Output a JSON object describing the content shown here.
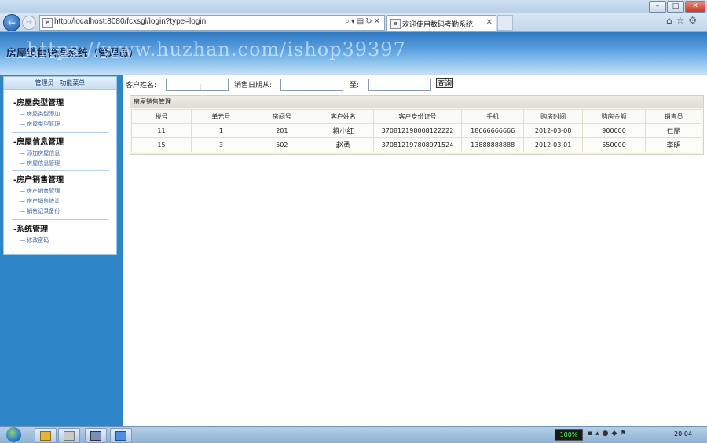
{
  "browser": {
    "url": "http://localhost:8080/fcxsgl/login?type=login",
    "tab_title": "欢迎使用数码考勤系统",
    "tab_close": "✕",
    "window_buttons": {
      "minimize": "–",
      "maximize": "□",
      "close": "✕"
    }
  },
  "header": {
    "title": "房屋销售管理系统（管理员）",
    "watermark": "https://www.huzhan.com/ishop39397"
  },
  "sidebar": {
    "header": "管理员 · 功能菜单",
    "groups": [
      {
        "title": "房屋类型管理",
        "items": [
          "房屋类型添加",
          "房屋类型管理"
        ]
      },
      {
        "title": "房屋信息管理",
        "items": [
          "添加房屋信息",
          "房屋信息管理"
        ]
      },
      {
        "title": "房产销售管理",
        "items": [
          "房产销售管理",
          "房产销售统计",
          "销售记录备份"
        ]
      },
      {
        "title": "系统管理",
        "items": [
          "修改密码"
        ]
      }
    ]
  },
  "search": {
    "customer_label": "客户姓名:",
    "date_from_label": "销售日期从:",
    "date_to_label": "至:",
    "customer_value": "",
    "date_from_value": "",
    "date_to_value": "",
    "query_button": "查询"
  },
  "grid": {
    "caption": "房屋销售管理",
    "columns": [
      "楼号",
      "单元号",
      "房间号",
      "客户姓名",
      "客户身份证号",
      "手机",
      "购房时间",
      "购房金额",
      "销售员"
    ],
    "rows": [
      [
        "11",
        "1",
        "201",
        "将小红",
        "370812198008122222",
        "18666666666",
        "2012-03-08",
        "900000",
        "仁丽"
      ],
      [
        "15",
        "3",
        "502",
        "赵勇",
        "370812197808971524",
        "13888888888",
        "2012-03-01",
        "550000",
        "李明"
      ]
    ]
  },
  "taskbar": {
    "battery": "100%",
    "clock": "20:04"
  }
}
